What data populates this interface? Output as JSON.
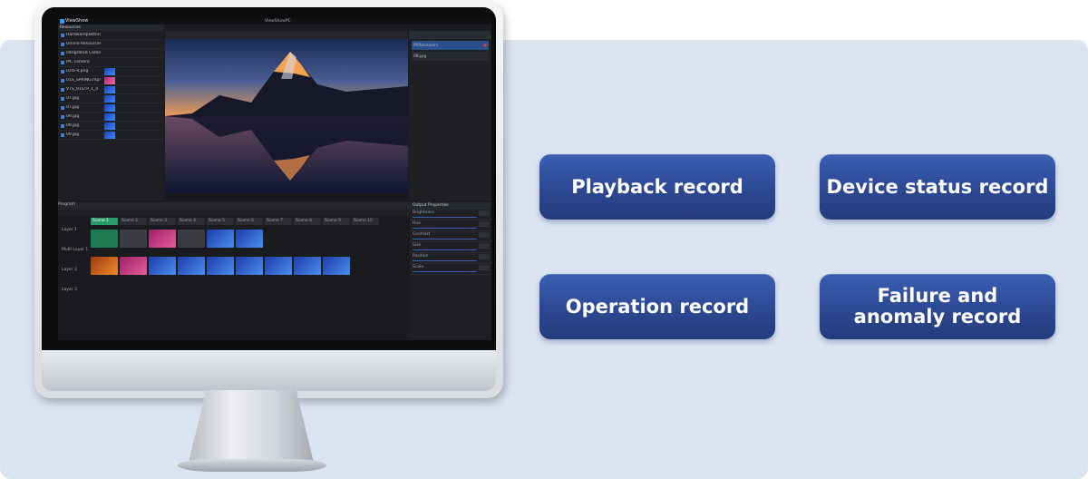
{
  "buttons": {
    "playback": "Playback record",
    "device_status": "Device status record",
    "operation": "Operation record",
    "failure": "Failure and\nanomaly record"
  },
  "screen": {
    "app_name": "ViewShow",
    "window_title": "ViewShowPC",
    "resources_label": "Resources",
    "program_label": "Program",
    "output_label": "Output Properties",
    "resource_rows": [
      {
        "name": "Hardwareplatform",
        "thumb": "none"
      },
      {
        "name": "Online Resources",
        "thumb": "none"
      },
      {
        "name": "Integrated Camera",
        "thumb": "none"
      },
      {
        "name": "IPC camera",
        "thumb": "none"
      },
      {
        "name": "LUI5-9.png",
        "thumb": "blue"
      },
      {
        "name": "01S_SPRING.mp4",
        "thumb": "pink"
      },
      {
        "name": "VTS_01STP_1_0",
        "thumb": "blue"
      },
      {
        "name": "07.jpg",
        "thumb": "blue"
      },
      {
        "name": "07.jpg",
        "thumb": "blue"
      },
      {
        "name": "09.jpg",
        "thumb": "blue"
      },
      {
        "name": "09.jpg",
        "thumb": "blue"
      },
      {
        "name": "09.jpg",
        "thumb": "blue"
      }
    ],
    "scenes": [
      "Scene 1",
      "Scene 2",
      "Scene 3",
      "Scene 4",
      "Scene 5",
      "Scene 6",
      "Scene 7",
      "Scene 8",
      "Scene 9",
      "Scene 10"
    ],
    "layers": [
      "Layer 1",
      "Multi Layer 1",
      "Layer 2",
      "Layer 3"
    ],
    "side_rows": [
      "IP/Receivers",
      "08.jpg"
    ],
    "props": [
      "Brightness",
      "Hue",
      "Contrast",
      "Size",
      "Position",
      "Scale"
    ]
  }
}
